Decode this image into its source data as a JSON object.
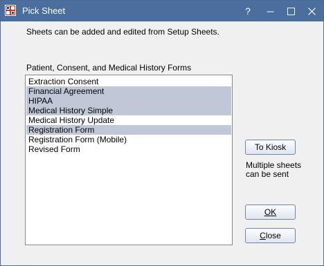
{
  "window": {
    "title": "Pick Sheet",
    "help_glyph": "?",
    "colors": {
      "titlebar": "#4a6e9e",
      "selected_row": "#c0c8d8"
    }
  },
  "info_text": "Sheets can be added and edited from Setup Sheets.",
  "list": {
    "label": "Patient, Consent, and Medical History Forms",
    "items": [
      {
        "label": "Extraction Consent",
        "selected": false
      },
      {
        "label": "Financial Agreement",
        "selected": true
      },
      {
        "label": "HIPAA",
        "selected": true
      },
      {
        "label": "Medical History Simple",
        "selected": true
      },
      {
        "label": "Medical History Update",
        "selected": false
      },
      {
        "label": "Registration Form",
        "selected": true
      },
      {
        "label": "Registration Form (Mobile)",
        "selected": false
      },
      {
        "label": "Revised Form",
        "selected": false
      }
    ]
  },
  "buttons": {
    "to_kiosk": "To Kiosk",
    "ok": "OK",
    "close": "Close"
  },
  "kiosk_note": "Multiple sheets can be sent"
}
